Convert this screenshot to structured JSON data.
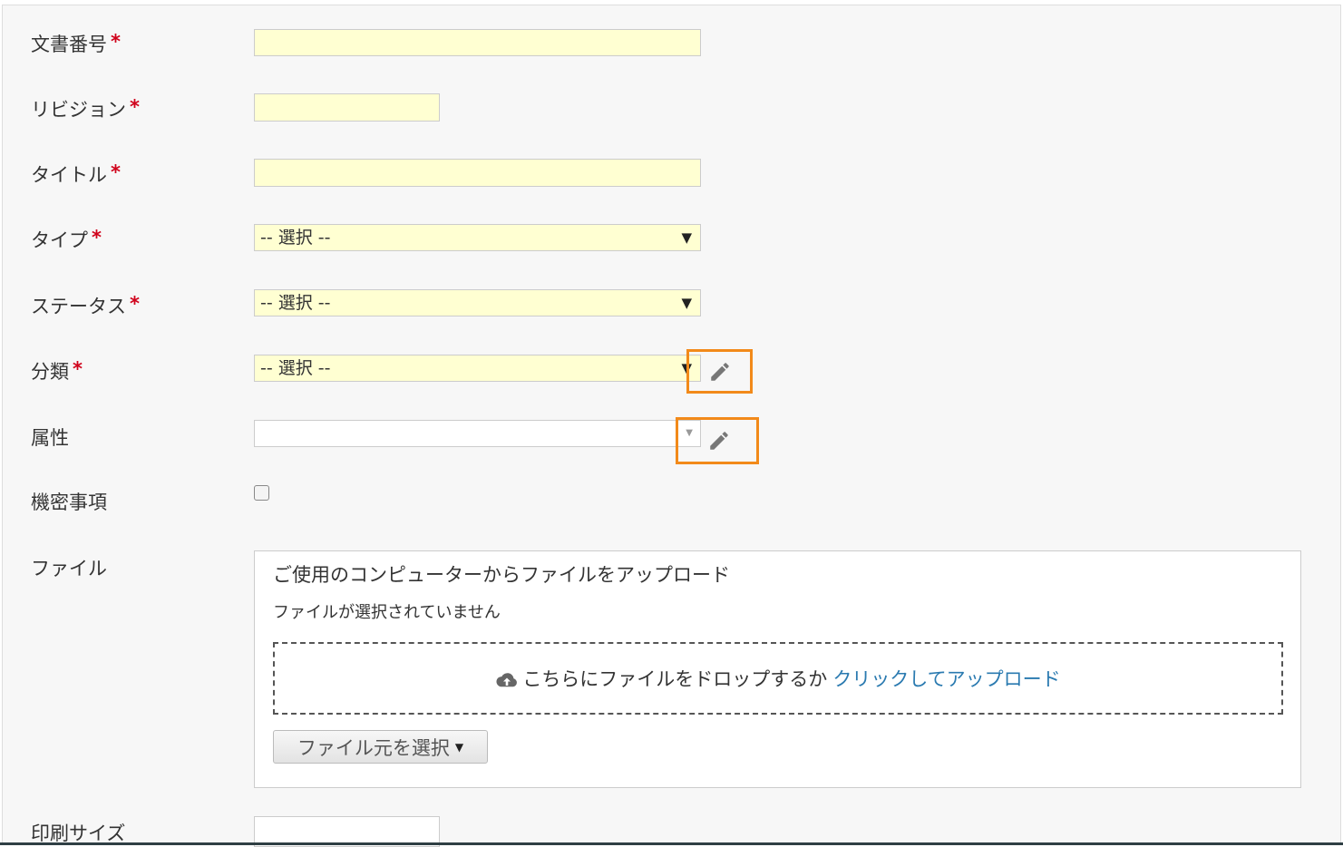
{
  "fields": {
    "doc_number": {
      "label": "文書番号",
      "required_mark": "*",
      "value": ""
    },
    "revision": {
      "label": "リビジョン",
      "required_mark": "*",
      "value": ""
    },
    "title": {
      "label": "タイトル",
      "required_mark": "*",
      "value": ""
    },
    "type": {
      "label": "タイプ",
      "required_mark": "*",
      "selected": "-- 選択 --"
    },
    "status": {
      "label": "ステータス",
      "required_mark": "*",
      "selected": "-- 選択 --"
    },
    "category": {
      "label": "分類",
      "required_mark": "*",
      "selected": "-- 選択 --"
    },
    "attribute": {
      "label": "属性",
      "value": ""
    },
    "confidential": {
      "label": "機密事項",
      "checked": false
    },
    "file": {
      "label": "ファイル",
      "upload_title": "ご使用のコンピューターからファイルをアップロード",
      "status": "ファイルが選択されていません",
      "drop_text": "こちらにファイルをドロップするか",
      "drop_link": "クリックしてアップロード",
      "source_button": "ファイル元を選択"
    },
    "print_size": {
      "label": "印刷サイズ",
      "value": ""
    }
  },
  "icons": {
    "select_arrow": "▼",
    "edit": "pencil-icon",
    "upload": "cloud-upload-icon",
    "dropdown_caret": "caret-down-icon"
  },
  "colors": {
    "required": "#d0021b",
    "highlight_box": "#f28a1a",
    "required_field_bg": "#ffffd2",
    "link": "#2a7ab0"
  }
}
